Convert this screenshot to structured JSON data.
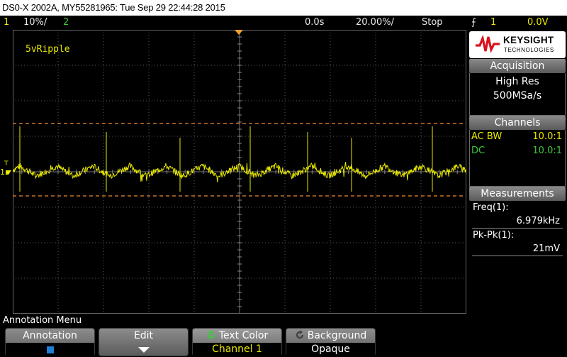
{
  "title": "DS0-X 2002A, MY55281965: Tue Sep 29 22:44:28 2015",
  "status": {
    "ch1_num": "1",
    "ch1_scale": "10%/",
    "ch2_num": "2",
    "time_pos": "0.0s",
    "time_scale": "20.00%/",
    "run_state": "Stop",
    "trig_icon": "trigger-edge-icon",
    "trig_src": "1",
    "trig_level": "0.0V"
  },
  "screen": {
    "annotation_text": "5vRipple",
    "ch_marker": "1",
    "trig_marker": "T"
  },
  "panel": {
    "logo_brand": "KEYSIGHT",
    "logo_sub": "TECHNOLOGIES",
    "acquisition_title": "Acquisition",
    "acq_mode": "High Res",
    "acq_rate": "500MSa/s",
    "channels_title": "Channels",
    "channel_rows": [
      {
        "label": "AC BW",
        "value": "10.0:1",
        "color": "#e8e800"
      },
      {
        "label": "DC",
        "value": "10.0:1",
        "color": "#3ec83e"
      }
    ],
    "measurements_title": "Measurements",
    "meas_1_label": "Freq(1):",
    "meas_1_value": "6.979kHz",
    "meas_2_label": "Pk-Pk(1):",
    "meas_2_value": "21mV"
  },
  "menu": {
    "title": "Annotation Menu",
    "softkeys": [
      {
        "top": "Annotation",
        "bottom_icon": "checkbox-icon"
      },
      {
        "top": "Edit",
        "bottom_icon": "down-arrow-icon"
      },
      {
        "top": "Text Color",
        "bottom": "Channel 1",
        "icon": "rotate-knob-icon"
      },
      {
        "top": "Background",
        "bottom": "Opaque",
        "icon": "rotate-knob-icon"
      }
    ]
  },
  "colors": {
    "trace": "#e8e800",
    "cursor": "#f08a30",
    "grid": "#5a5a5a"
  }
}
